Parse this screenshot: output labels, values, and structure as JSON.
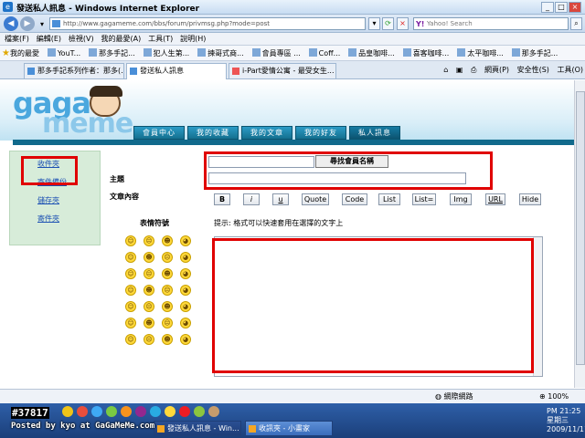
{
  "window": {
    "title": "發送私人訊息 - Windows Internet Explorer"
  },
  "address": {
    "url": "http://www.gagameme.com/bbs/forum/privmsg.php?mode=post"
  },
  "search": {
    "placeholder": "Yahoo! Search"
  },
  "menu": [
    "檔案(F)",
    "編輯(E)",
    "檢視(V)",
    "我的最愛(A)",
    "工具(T)",
    "說明(H)"
  ],
  "favorites": {
    "label": "我的最愛",
    "items": [
      "YouT...",
      "那多手記...",
      "犯人生第...",
      "揀哥式商...",
      "會員專區 ...",
      "Coff...",
      "品皇咖啡...",
      "喜客咖啡...",
      "太平咖啡...",
      "那多手記..."
    ]
  },
  "tabs": [
    {
      "label": "那多手記系列作者：那多(..."
    },
    {
      "label": "發送私人訊息"
    },
    {
      "label": "i-Part愛情公寓 - 最受女生..."
    }
  ],
  "tools": {
    "page": "網頁(P)",
    "safety": "安全性(S)",
    "tools": "工具(O)"
  },
  "site": {
    "logo_top": "gaga",
    "logo_bottom": "meme",
    "nav": [
      "會員中心",
      "我的收藏",
      "我的文章",
      "我的好友",
      "私人訊息"
    ],
    "sidebar": [
      "收件夾",
      "寄件備份",
      "儲存夾",
      "寄件夾"
    ]
  },
  "form": {
    "find_member": "尋找會員名稱",
    "subject_label": "主題",
    "content_label": "文章內容",
    "emoticons_label": "表情符號",
    "hint": "提示: 格式可以快速套用在選擇的文字上",
    "format_buttons": [
      "B",
      "i",
      "u",
      "Quote",
      "Code",
      "List",
      "List=",
      "Img",
      "URL",
      "Hide"
    ]
  },
  "status": {
    "zone": "網際網路",
    "zoom": "100%"
  },
  "taskbar": {
    "buttons": [
      "發送私人訊息 - Win...",
      "收訊夾 - 小畫家"
    ],
    "time": "PM 21:25",
    "weekday": "星期三",
    "date": "2009/11/11"
  },
  "watermark": {
    "number": "#37817",
    "posted": "Posted by kyo at GaGaMeMe.com"
  },
  "emoticons": [
    "smile",
    "sad",
    "wink",
    "grin",
    "happy",
    "cool",
    "angry",
    "tongue",
    "blush",
    "shock",
    "cry",
    "laugh",
    "love",
    "mad",
    "sleep",
    "confused",
    "evil",
    "kiss",
    "sick",
    "surprised",
    "nerd",
    "shy",
    "whistle",
    "wow",
    "yum",
    "zzz",
    "ok",
    "oops"
  ]
}
